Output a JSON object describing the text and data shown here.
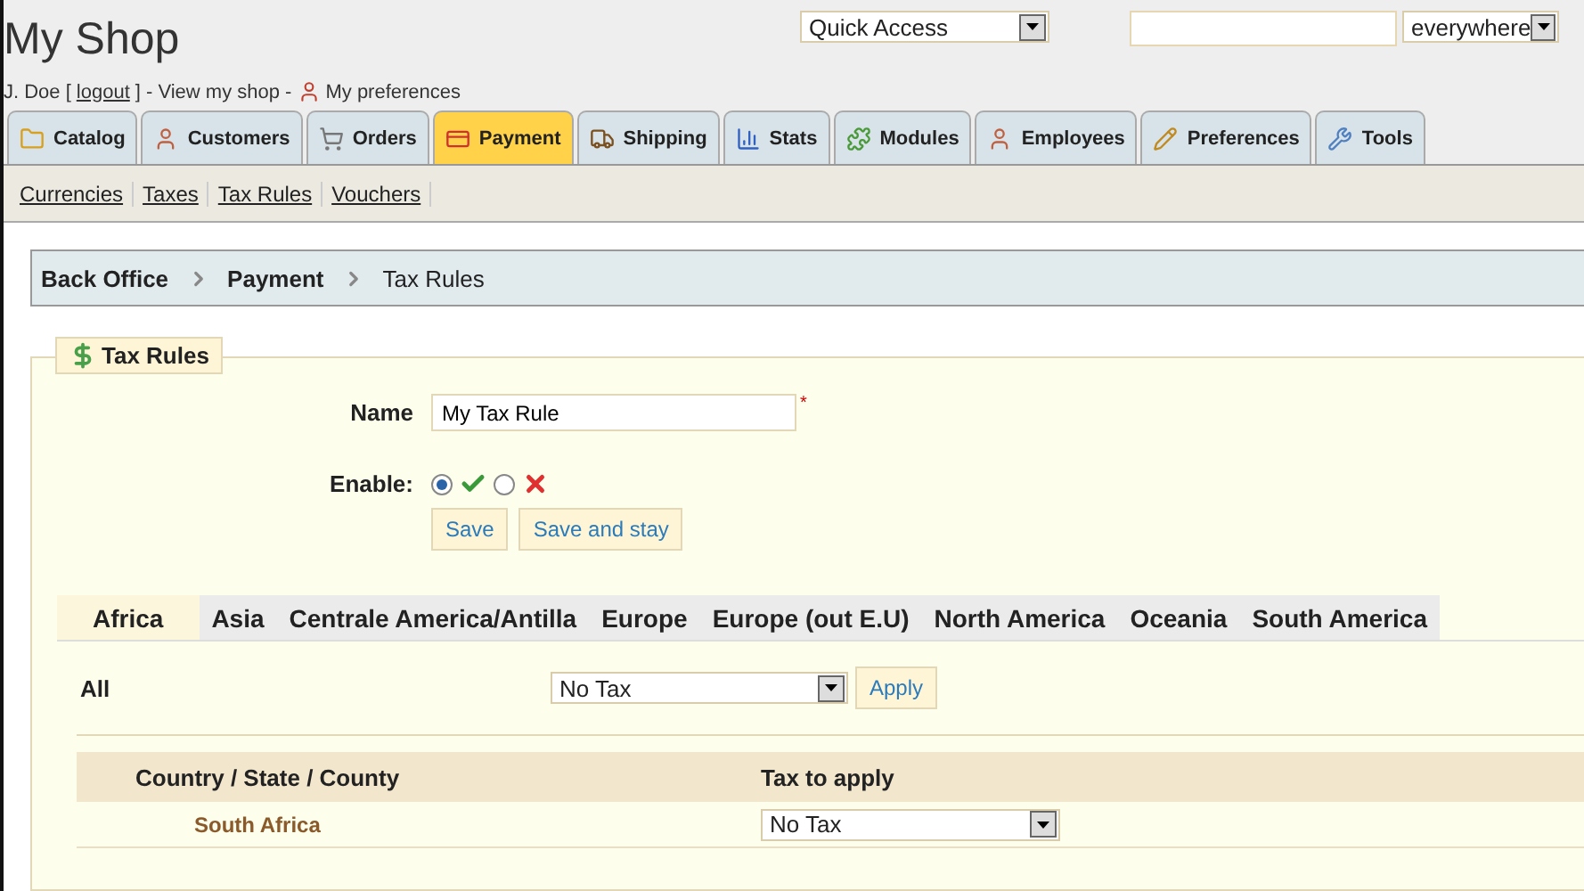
{
  "header": {
    "title": "My Shop",
    "user_line": {
      "user": "J. Doe [",
      "logout": "logout",
      "after": "] - View my shop -",
      "preferences": "My preferences"
    },
    "quick_access": "Quick Access",
    "search": {
      "scope": "everywhere"
    }
  },
  "tabs": [
    {
      "label": "Catalog",
      "selected": false
    },
    {
      "label": "Customers",
      "selected": false
    },
    {
      "label": "Orders",
      "selected": false
    },
    {
      "label": "Payment",
      "selected": true
    },
    {
      "label": "Shipping",
      "selected": false
    },
    {
      "label": "Stats",
      "selected": false
    },
    {
      "label": "Modules",
      "selected": false
    },
    {
      "label": "Employees",
      "selected": false
    },
    {
      "label": "Preferences",
      "selected": false
    },
    {
      "label": "Tools",
      "selected": false
    }
  ],
  "subnav": [
    "Currencies",
    "Taxes",
    "Tax Rules",
    "Vouchers"
  ],
  "breadcrumb": [
    "Back Office",
    "Payment",
    "Tax Rules"
  ],
  "form": {
    "legend": "Tax Rules",
    "name_label": "Name",
    "name_value": "My Tax Rule",
    "required_mark": "*",
    "enable_label": "Enable:",
    "enabled": true,
    "buttons": [
      "Save",
      "Save and stay"
    ]
  },
  "regions": [
    {
      "label": "Africa",
      "selected": true
    },
    {
      "label": "Asia",
      "selected": false
    },
    {
      "label": "Centrale America/Antilla",
      "selected": false
    },
    {
      "label": "Europe",
      "selected": false
    },
    {
      "label": "Europe (out E.U)",
      "selected": false
    },
    {
      "label": "North America",
      "selected": false
    },
    {
      "label": "Oceania",
      "selected": false
    },
    {
      "label": "South America",
      "selected": false
    }
  ],
  "all_row": {
    "label": "All",
    "value": "No Tax",
    "button": "Apply"
  },
  "table": {
    "columns": [
      "Country / State / County",
      "Tax to apply"
    ],
    "rows": [
      {
        "country": "South Africa",
        "tax": "No Tax"
      }
    ]
  }
}
